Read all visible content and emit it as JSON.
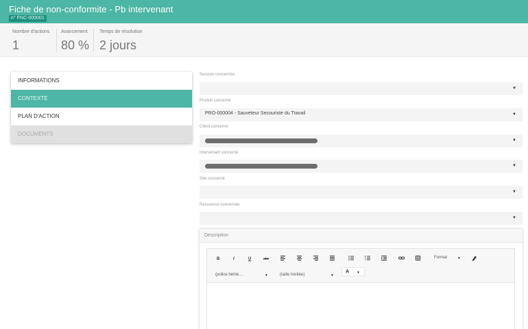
{
  "header": {
    "title": "Fiche de non-conformite - Pb intervenant",
    "badge": "n° FNC-000001"
  },
  "stats": [
    {
      "label": "Nombre d'actions",
      "value": "1"
    },
    {
      "label": "Avancement",
      "value": "80 %"
    },
    {
      "label": "Temps de résolution",
      "value": "2 jours"
    }
  ],
  "menu": {
    "items": [
      {
        "label": "INFORMATIONS",
        "state": "normal"
      },
      {
        "label": "CONTEXTE",
        "state": "active"
      },
      {
        "label": "PLAN D'ACTION",
        "state": "normal"
      },
      {
        "label": "DOCUMENTS",
        "state": "disabled"
      }
    ]
  },
  "form": {
    "session": {
      "label": "Session concernée",
      "value": ""
    },
    "produit": {
      "label": "Produit concerné",
      "value": "PRO-000004 - Sauveteur Secouriste du Travail"
    },
    "client": {
      "label": "Client concerné",
      "value": "",
      "redacted": true
    },
    "intervenant": {
      "label": "Intervenant concerné",
      "value": "",
      "redacted": true
    },
    "site": {
      "label": "Site concerné",
      "value": ""
    },
    "ressource": {
      "label": "Ressource concernée",
      "value": ""
    },
    "caret": "▼"
  },
  "description": {
    "title": "Description",
    "toolbar": {
      "bold": "B",
      "italic": "I",
      "underline": "U",
      "strike": "abc",
      "format_label": "Format",
      "font_family": "(police hérité…",
      "font_size": "(taille héritée)",
      "text_color": "A"
    }
  },
  "colors": {
    "accent": "#4db6a6",
    "badge": "#1f9080",
    "disabled": "#e0e0e0"
  }
}
